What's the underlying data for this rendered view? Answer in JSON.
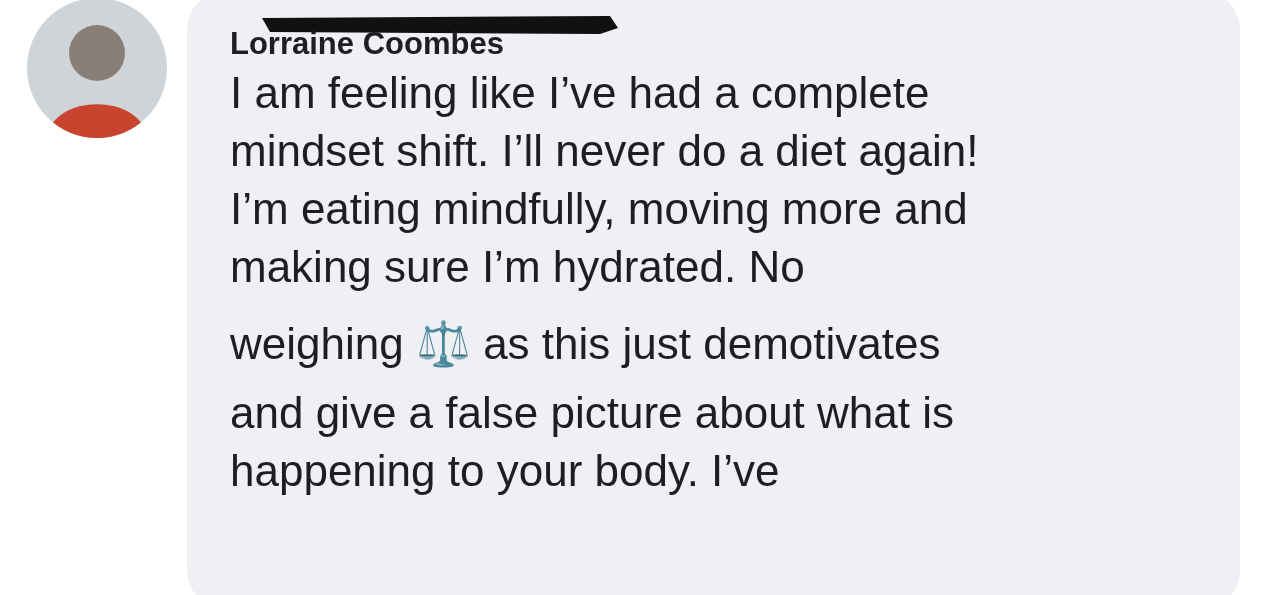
{
  "comment": {
    "author": "Lorraine Coombes",
    "lines": [
      "I am feeling like I’ve had a complete",
      "mindset shift. I’ll never do a diet again!",
      "I’m eating mindfully, moving more and",
      "making sure I’m hydrated. No",
      "weighing ⚖️ as this just demotivates",
      "and give a false picture about what is",
      "happening to your body. I’ve"
    ]
  }
}
